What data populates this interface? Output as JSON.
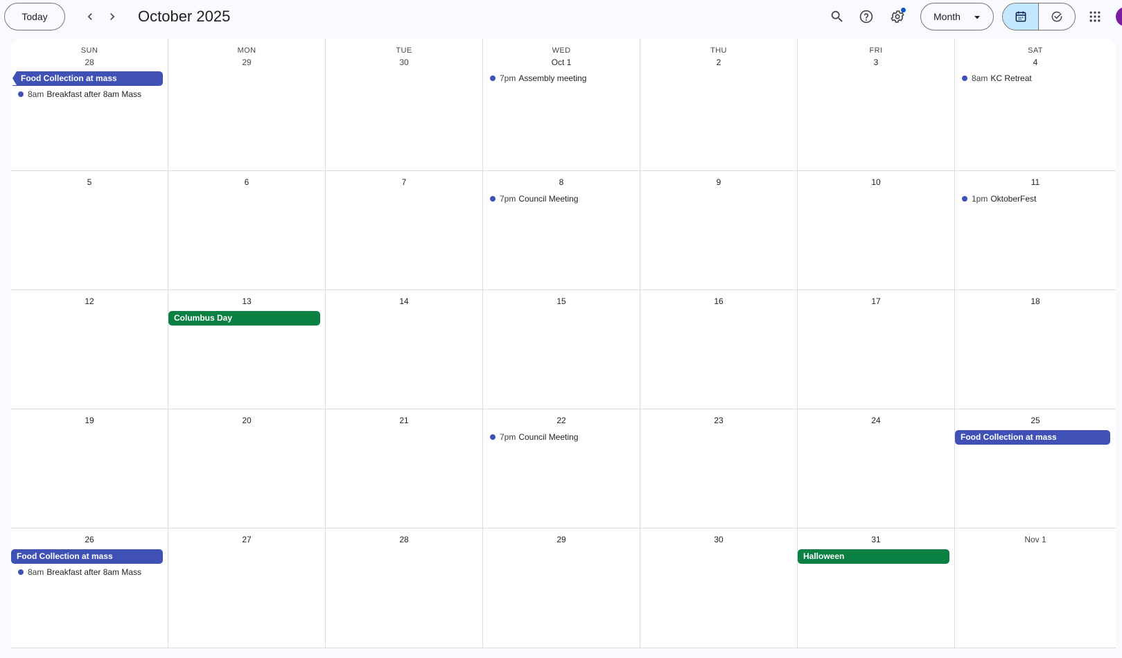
{
  "toolbar": {
    "today_label": "Today",
    "title": "October 2025",
    "view_label": "Month"
  },
  "icons": {
    "prev": "chevron-left-icon",
    "next": "chevron-right-icon",
    "search": "search-icon",
    "help": "help-icon",
    "settings": "gear-icon",
    "calendar_view": "calendar-icon",
    "tasks_view": "check-circle-icon",
    "apps": "apps-grid-icon"
  },
  "colors": {
    "event_blue": "#3f51b5",
    "event_green": "#0b8043",
    "active_segment": "#c2e7ff"
  },
  "calendar": {
    "weekdays": [
      "SUN",
      "MON",
      "TUE",
      "WED",
      "THU",
      "FRI",
      "SAT"
    ],
    "weeks": [
      [
        "28",
        "29",
        "30",
        "Oct 1",
        "2",
        "3",
        "4"
      ],
      [
        "5",
        "6",
        "7",
        "8",
        "9",
        "10",
        "11"
      ],
      [
        "12",
        "13",
        "14",
        "15",
        "16",
        "17",
        "18"
      ],
      [
        "19",
        "20",
        "21",
        "22",
        "23",
        "24",
        "25"
      ],
      [
        "26",
        "27",
        "28",
        "29",
        "30",
        "31",
        "Nov 1"
      ]
    ],
    "events": [
      {
        "week": 0,
        "day": 0,
        "kind": "allday",
        "color": "blue",
        "continued": true,
        "title": "Food Collection at mass"
      },
      {
        "week": 0,
        "day": 0,
        "kind": "timed",
        "slot": 1,
        "time": "8am",
        "title": "Breakfast after 8am Mass"
      },
      {
        "week": 0,
        "day": 3,
        "kind": "timed",
        "slot": 0,
        "time": "7pm",
        "title": "Assembly meeting"
      },
      {
        "week": 0,
        "day": 6,
        "kind": "timed",
        "slot": 0,
        "time": "8am",
        "title": "KC Retreat"
      },
      {
        "week": 1,
        "day": 3,
        "kind": "timed",
        "slot": 0,
        "time": "7pm",
        "title": "Council Meeting"
      },
      {
        "week": 1,
        "day": 6,
        "kind": "timed",
        "slot": 0,
        "time": "1pm",
        "title": "OktoberFest"
      },
      {
        "week": 2,
        "day": 1,
        "kind": "allday",
        "color": "green",
        "title": "Columbus Day"
      },
      {
        "week": 3,
        "day": 3,
        "kind": "timed",
        "slot": 0,
        "time": "7pm",
        "title": "Council Meeting"
      },
      {
        "week": 3,
        "day": 6,
        "kind": "allday",
        "color": "blue",
        "title": "Food Collection at mass"
      },
      {
        "week": 4,
        "day": 0,
        "kind": "allday",
        "color": "blue",
        "title": "Food Collection at mass"
      },
      {
        "week": 4,
        "day": 0,
        "kind": "timed",
        "slot": 1,
        "time": "8am",
        "title": "Breakfast after 8am Mass"
      },
      {
        "week": 4,
        "day": 5,
        "kind": "allday",
        "color": "green",
        "title": "Halloween"
      }
    ]
  }
}
